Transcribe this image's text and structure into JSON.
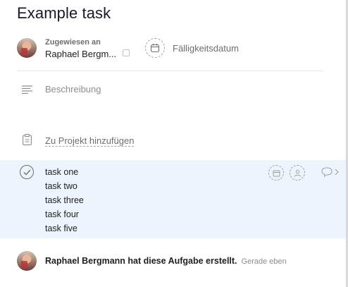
{
  "task": {
    "title": "Example task"
  },
  "assignee": {
    "label": "Zugewiesen an",
    "name": "Raphael Bergm..."
  },
  "due_date": {
    "label": "Fälligkeitsdatum"
  },
  "description": {
    "placeholder": "Beschreibung"
  },
  "project": {
    "link": "Zu Projekt hinzufügen"
  },
  "subtasks": {
    "lines": [
      "task one",
      "task two",
      "task three",
      "task four",
      "task five"
    ]
  },
  "activity": {
    "text": "Raphael Bergmann hat diese Aufgabe erstellt.",
    "time": "Gerade eben"
  },
  "colors": {
    "subtask_bg": "#edf4fc",
    "text": "#1e1f21",
    "muted": "#6d6e6f"
  },
  "icons": [
    "calendar-icon",
    "description-icon",
    "clipboard-icon",
    "check-icon",
    "person-icon",
    "comment-icon",
    "chevron-right-icon"
  ]
}
